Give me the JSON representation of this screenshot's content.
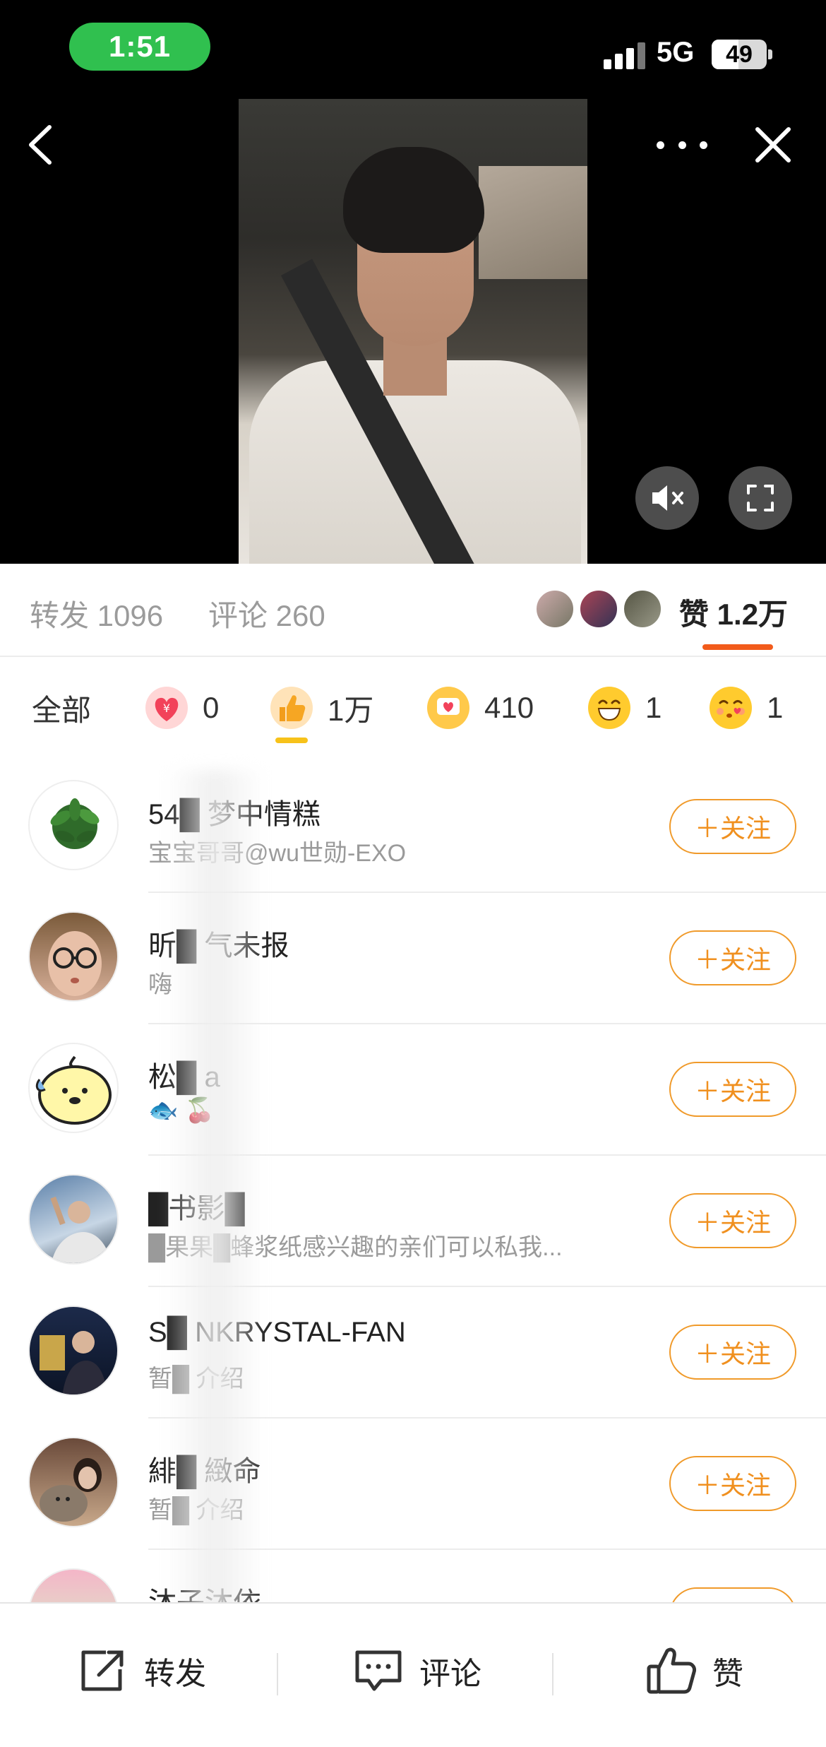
{
  "status_bar": {
    "time": "1:51",
    "network": "5G",
    "battery": "49",
    "battery_level": 0.49
  },
  "video": {
    "muted": true
  },
  "stats": {
    "share_label": "转发 1096",
    "comment_label": "评论 260",
    "like_label": "赞 1.2万"
  },
  "reactions": [
    {
      "icon": "heart-money-icon",
      "count": "0"
    },
    {
      "icon": "thumbs-up-icon",
      "count": "1万"
    },
    {
      "icon": "heart-bubble-icon",
      "count": "410"
    },
    {
      "icon": "laugh-icon",
      "count": "1"
    },
    {
      "icon": "kiss-icon",
      "count": "1"
    }
  ],
  "reaction_all_label": "全部",
  "follow_label": "＋关注",
  "users": [
    {
      "name": "54█ 梦中情糕",
      "bio": "宝宝哥哥@wu世勋-EXO"
    },
    {
      "name": "昕█ 气未报",
      "bio": "嗨"
    },
    {
      "name": "松█ a",
      "bio": "🐟 🍒"
    },
    {
      "name": "█书影█",
      "bio": "█果果█蜂浆纸感兴趣的亲们可以私我..."
    },
    {
      "name": "S█ NKRYSTAL-FAN",
      "bio": "暂█ 介绍"
    },
    {
      "name": "緋█ 緻命",
      "bio": "暂█ 介绍"
    },
    {
      "name": "沐子沐依",
      "bio": ""
    }
  ],
  "bottom_bar": {
    "share": "转发",
    "comment": "评论",
    "like": "赞"
  },
  "colors": {
    "accent": "#f0901f",
    "like_underline": "#f25b1b",
    "status_green": "#30c04f"
  }
}
